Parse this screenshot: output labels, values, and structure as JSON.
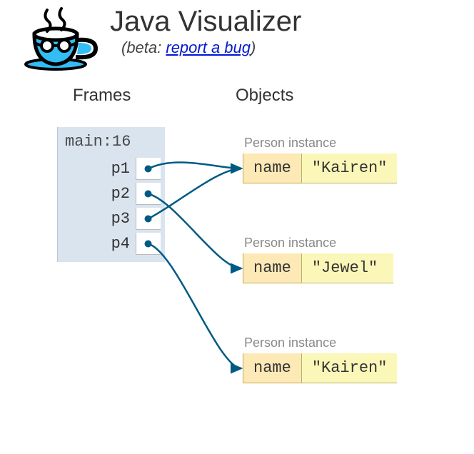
{
  "header": {
    "title": "Java Visualizer",
    "subtitle_prefix": "(beta: ",
    "subtitle_link": "report a bug",
    "subtitle_suffix": ")"
  },
  "columns": {
    "frames_label": "Frames",
    "objects_label": "Objects"
  },
  "frame": {
    "title": "main:16",
    "vars": [
      {
        "name": "p1"
      },
      {
        "name": "p2"
      },
      {
        "name": "p3"
      },
      {
        "name": "p4"
      }
    ]
  },
  "objects": [
    {
      "type_label": "Person instance",
      "field_key": "name",
      "field_value": "\"Kairen\""
    },
    {
      "type_label": "Person instance",
      "field_key": "name",
      "field_value": "\"Jewel\""
    },
    {
      "type_label": "Person instance",
      "field_key": "name",
      "field_value": "\"Kairen\""
    }
  ],
  "arrows": [
    {
      "from_var": "p1",
      "to_obj": 0
    },
    {
      "from_var": "p2",
      "to_obj": 1
    },
    {
      "from_var": "p3",
      "to_obj": 0
    },
    {
      "from_var": "p4",
      "to_obj": 2
    }
  ],
  "colors": {
    "arrow": "#005a84"
  }
}
